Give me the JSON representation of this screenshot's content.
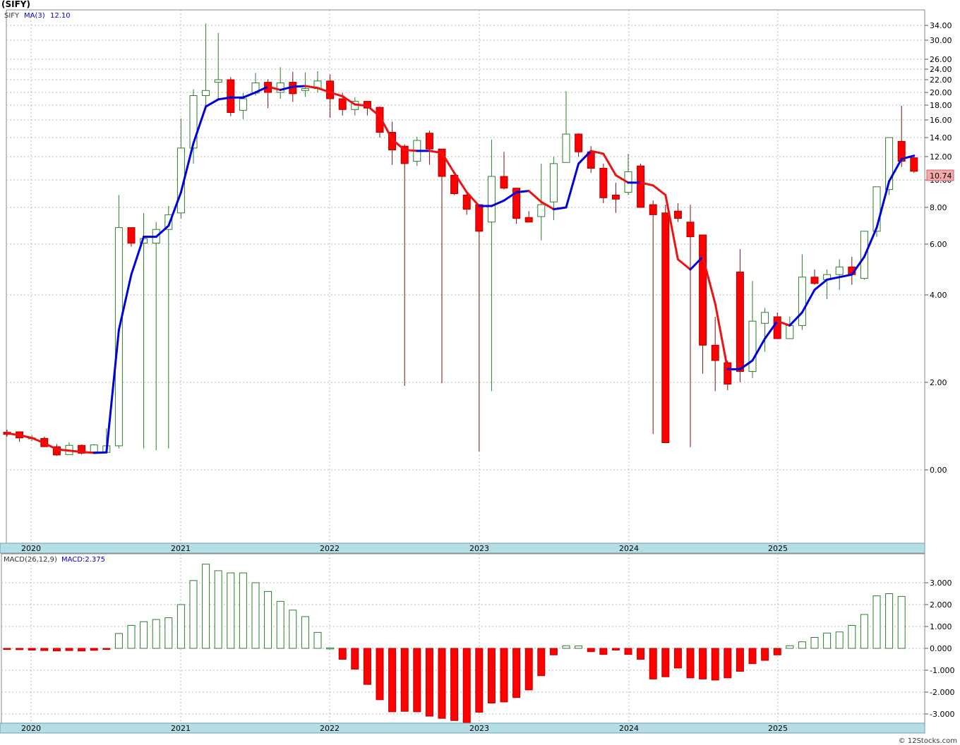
{
  "chart_title": "(SIFY)",
  "footer_text": "© 12Stocks.com",
  "legend": {
    "symbol": "SIFY",
    "ma_label": "MA(3)",
    "ma_value": "12.10",
    "macd_label": "MACD(26,12,9)",
    "macd_value_label": "MACD:2.375"
  },
  "last_price_label": "10.74",
  "colors": {
    "up": "#006400",
    "down": "#ff0000",
    "ma_rising": "#0000dd",
    "ma_falling": "#ee1111",
    "axis_band": "#b5dde6"
  },
  "chart_data": [
    {
      "type": "candlestick",
      "scale": "log",
      "x_labels": [
        "2020",
        "2021",
        "2022",
        "2023",
        "2024",
        "2025"
      ],
      "y_ticks": [
        "34.00",
        "30.00",
        "26.00",
        "24.00",
        "22.00",
        "20.00",
        "18.00",
        "16.00",
        "14.00",
        "12.00",
        "10.00",
        "8.00",
        "6.00",
        "4.00",
        "2.00",
        "0.00"
      ],
      "candles": [
        [
          0.86,
          0.92,
          0.76,
          0.81
        ],
        [
          0.87,
          0.88,
          0.64,
          0.73
        ],
        [
          0.71,
          0.8,
          0.66,
          0.73
        ],
        [
          0.72,
          0.76,
          0.53,
          0.53
        ],
        [
          0.53,
          0.59,
          0.32,
          0.34
        ],
        [
          0.35,
          0.63,
          0.41,
          0.56
        ],
        [
          0.56,
          0.58,
          0.35,
          0.38
        ],
        [
          0.41,
          0.59,
          0.36,
          0.57
        ],
        [
          0.4,
          0.95,
          0.38,
          0.55
        ],
        [
          0.55,
          8.9,
          0.49,
          6.9
        ],
        [
          6.9,
          6.9,
          5.9,
          6.05
        ],
        [
          6.05,
          7.7,
          0.49,
          6.3
        ],
        [
          6.05,
          7.2,
          0.45,
          6.8
        ],
        [
          6.8,
          8.1,
          0.49,
          7.6
        ],
        [
          7.7,
          16.2,
          7.4,
          12.9
        ],
        [
          12.9,
          20.5,
          11.4,
          19.5
        ],
        [
          19.5,
          34.5,
          17.6,
          20.3
        ],
        [
          21.6,
          32.0,
          19.0,
          22.0
        ],
        [
          22.0,
          22.5,
          16.5,
          17.0
        ],
        [
          17.3,
          19.9,
          16.1,
          19.0
        ],
        [
          19.9,
          23.3,
          19.5,
          21.5
        ],
        [
          21.6,
          22.1,
          17.6,
          20.0
        ],
        [
          20.0,
          24.4,
          19.0,
          21.5
        ],
        [
          21.6,
          23.5,
          18.5,
          19.8
        ],
        [
          20.3,
          23.4,
          19.3,
          20.6
        ],
        [
          20.6,
          23.6,
          20.0,
          21.8
        ],
        [
          21.8,
          23.0,
          16.3,
          19.0
        ],
        [
          19.0,
          19.9,
          16.6,
          17.4
        ],
        [
          17.4,
          19.2,
          16.6,
          18.6
        ],
        [
          18.6,
          18.6,
          16.6,
          17.6
        ],
        [
          17.7,
          17.8,
          14.0,
          14.6
        ],
        [
          14.6,
          15.8,
          11.3,
          12.7
        ],
        [
          13.1,
          13.3,
          1.92,
          11.4
        ],
        [
          11.6,
          14.1,
          11.2,
          13.7
        ],
        [
          14.5,
          14.8,
          11.3,
          12.8
        ],
        [
          12.8,
          12.8,
          1.98,
          10.3
        ],
        [
          10.4,
          10.4,
          8.9,
          9.0
        ],
        [
          8.9,
          9.2,
          7.6,
          7.9
        ],
        [
          8.2,
          8.2,
          0.42,
          6.7
        ],
        [
          7.2,
          13.8,
          1.8,
          10.3
        ],
        [
          10.3,
          12.5,
          9.3,
          9.4
        ],
        [
          9.4,
          9.4,
          7.1,
          7.4
        ],
        [
          7.45,
          7.8,
          7.3,
          7.2
        ],
        [
          7.5,
          11.4,
          6.2,
          8.2
        ],
        [
          8.4,
          12.0,
          7.3,
          11.4
        ],
        [
          11.5,
          20.2,
          11.5,
          14.4
        ],
        [
          14.4,
          14.5,
          12.0,
          12.5
        ],
        [
          12.5,
          13.1,
          10.6,
          11.0
        ],
        [
          11.0,
          11.4,
          8.3,
          8.7
        ],
        [
          8.9,
          9.8,
          7.7,
          8.6
        ],
        [
          9.1,
          12.3,
          8.9,
          10.7
        ],
        [
          11.2,
          11.4,
          8.7,
          8.0
        ],
        [
          8.2,
          8.5,
          0.82,
          7.6
        ],
        [
          7.7,
          8.2,
          0.63,
          0.62
        ],
        [
          7.8,
          8.3,
          7.2,
          7.4
        ],
        [
          7.2,
          8.2,
          0.52,
          6.4
        ],
        [
          6.5,
          6.5,
          2.2,
          2.85
        ],
        [
          2.85,
          3.5,
          1.8,
          2.5
        ],
        [
          2.45,
          2.5,
          1.82,
          1.96
        ],
        [
          4.9,
          5.8,
          2.0,
          2.25
        ],
        [
          2.25,
          4.55,
          2.1,
          3.4
        ],
        [
          3.35,
          3.7,
          2.7,
          3.6
        ],
        [
          3.5,
          3.6,
          3.0,
          3.0
        ],
        [
          3.0,
          3.5,
          3.0,
          3.3
        ],
        [
          3.3,
          5.6,
          3.2,
          4.7
        ],
        [
          4.7,
          5.0,
          4.4,
          4.45
        ],
        [
          4.6,
          5.0,
          3.9,
          4.8
        ],
        [
          4.8,
          5.4,
          4.2,
          5.1
        ],
        [
          5.1,
          5.5,
          4.4,
          4.8
        ],
        [
          4.65,
          5.5,
          4.6,
          6.7
        ],
        [
          6.7,
          7.2,
          6.4,
          9.5
        ],
        [
          9.3,
          14.0,
          8.9,
          14.0
        ],
        [
          13.6,
          17.9,
          11.1,
          11.6
        ],
        [
          11.9,
          12.0,
          10.6,
          10.74
        ]
      ],
      "ma3": [
        0.84,
        0.79,
        0.73,
        0.61,
        0.47,
        0.44,
        0.41,
        0.39,
        0.4,
        3.2,
        4.8,
        6.4,
        6.4,
        7.0,
        9.1,
        13.4,
        17.8,
        18.9,
        19.2,
        19.2,
        20.0,
        20.9,
        20.4,
        20.9,
        21.0,
        20.7,
        20.0,
        19.4,
        18.1,
        17.9,
        16.5,
        13.8,
        12.7,
        12.6,
        12.6,
        12.4,
        10.6,
        9.1,
        8.1,
        8.1,
        8.5,
        9.1,
        9.2,
        8.4,
        7.9,
        8.0,
        11.4,
        12.6,
        12.3,
        10.4,
        9.8,
        9.8,
        9.6,
        8.9,
        5.4,
        5.0,
        5.5,
        3.8,
        2.3,
        2.3,
        2.5,
        3.0,
        3.4,
        3.3,
        3.6,
        4.2,
        4.6,
        4.7,
        4.8,
        5.5,
        6.9,
        9.9,
        11.8,
        12.1
      ]
    },
    {
      "type": "bar",
      "series_name": "MACD",
      "y_ticks": [
        "3.000",
        "2.000",
        "1.000",
        "0.000",
        "-1.000",
        "-2.000",
        "-3.000"
      ],
      "x_labels": [
        "2020",
        "2021",
        "2022",
        "2023",
        "2024",
        "2025"
      ],
      "values": [
        -0.05,
        -0.06,
        -0.08,
        -0.1,
        -0.12,
        -0.1,
        -0.12,
        -0.09,
        -0.05,
        0.68,
        1.05,
        1.22,
        1.32,
        1.4,
        2.0,
        3.1,
        3.85,
        3.55,
        3.45,
        3.45,
        3.0,
        2.6,
        2.15,
        1.75,
        1.45,
        0.73,
        0.02,
        -0.5,
        -0.95,
        -1.65,
        -2.35,
        -2.9,
        -2.88,
        -2.9,
        -3.1,
        -3.2,
        -3.3,
        -3.5,
        -2.92,
        -2.5,
        -2.45,
        -2.25,
        -1.9,
        -1.25,
        -0.3,
        0.12,
        0.11,
        -0.15,
        -0.28,
        -0.08,
        -0.28,
        -0.5,
        -1.4,
        -1.3,
        -0.9,
        -1.35,
        -1.4,
        -1.45,
        -1.35,
        -1.05,
        -0.7,
        -0.55,
        -0.3,
        0.12,
        0.3,
        0.5,
        0.7,
        0.75,
        1.05,
        1.55,
        2.4,
        2.5,
        2.375
      ]
    }
  ]
}
